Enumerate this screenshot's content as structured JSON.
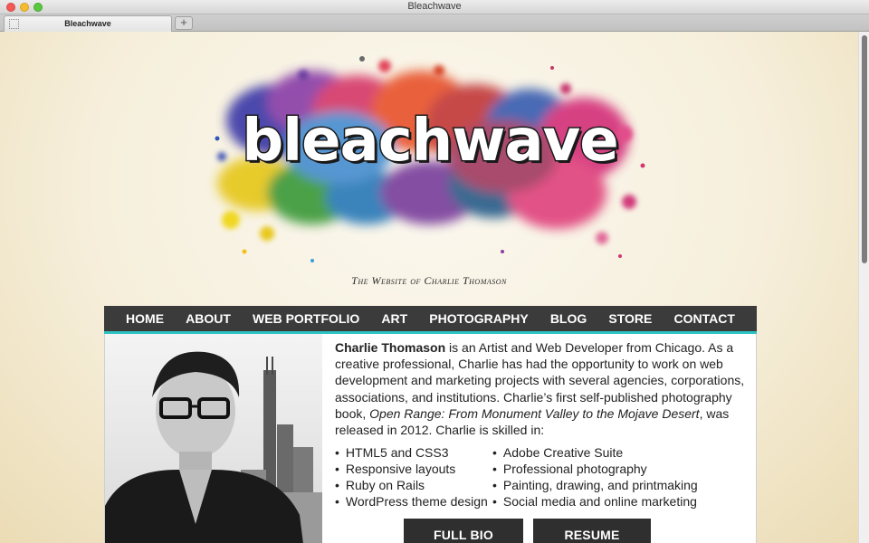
{
  "window": {
    "title": "Bleachwave"
  },
  "tabs": [
    {
      "label": "Bleachwave"
    }
  ],
  "new_tab": "+",
  "logo": {
    "text": "bleachwave"
  },
  "tagline": "The Website of Charlie Thomason",
  "nav": [
    {
      "label": "HOME"
    },
    {
      "label": "ABOUT"
    },
    {
      "label": "WEB PORTFOLIO"
    },
    {
      "label": "ART"
    },
    {
      "label": "PHOTOGRAPHY"
    },
    {
      "label": "BLOG"
    },
    {
      "label": "STORE"
    },
    {
      "label": "CONTACT"
    }
  ],
  "bio": {
    "name": "Charlie Thomason",
    "text1": " is an Artist and Web Developer from Chicago. As a creative professional, Charlie has had the opportunity to work on web development and marketing projects with several agencies, corporations, associations, and institutions. Charlie’s first self-published photography book, ",
    "book": "Open Range: From Monument Valley to the Mojave Desert",
    "text2": ", was released in 2012. Charlie is skilled in:"
  },
  "skills": {
    "left": [
      "HTML5 and CSS3",
      "Responsive layouts",
      "Ruby on Rails",
      "WordPress theme design"
    ],
    "right": [
      "Adobe Creative Suite",
      "Professional photography",
      "Painting, drawing, and printmaking",
      "Social media and online marketing"
    ]
  },
  "buttons": {
    "full_bio": "FULL BIO",
    "resume": "RESUME"
  },
  "colors": {
    "nav_bg": "#3b3b3b",
    "nav_accent": "#2fc4c4",
    "button_bg": "#2f2f2f",
    "page_bg": "#f6efdc"
  }
}
